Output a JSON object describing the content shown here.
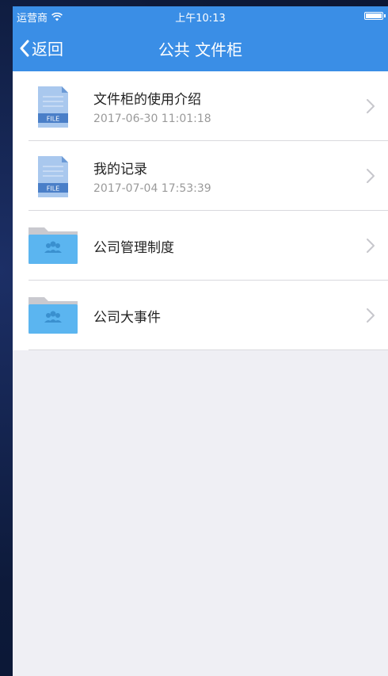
{
  "status_bar": {
    "carrier": "运营商",
    "time": "上午10:13"
  },
  "nav": {
    "back_label": "返回",
    "title": "公共 文件柜"
  },
  "items": [
    {
      "type": "file",
      "title": "文件柜的使用介绍",
      "date": "2017-06-30 11:01:18",
      "badge": "FILE"
    },
    {
      "type": "file",
      "title": "我的记录",
      "date": "2017-07-04 17:53:39",
      "badge": "FILE"
    },
    {
      "type": "folder",
      "title": "公司管理制度"
    },
    {
      "type": "folder",
      "title": "公司大事件"
    }
  ],
  "colors": {
    "accent": "#3a8ee6",
    "folder": "#5bb5f0",
    "file_icon": "#a9c8ee"
  }
}
